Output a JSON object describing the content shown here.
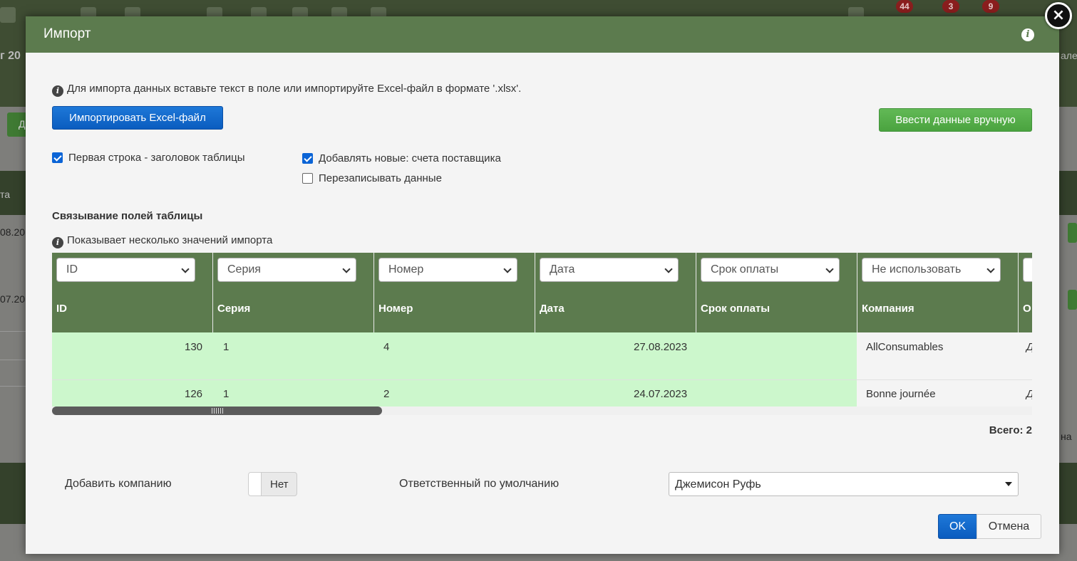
{
  "modal": {
    "title": "Импорт",
    "import_hint": "Для импорта данных вставьте текст в поле или импортируйте Excel-файл в формате '.xlsx'.",
    "import_excel_label": "Импортировать Excel-файл",
    "manual_entry_label": "Ввести данные вручную",
    "options": {
      "first_row_header": {
        "label": "Первая строка - заголовок таблицы",
        "checked": true
      },
      "add_new": {
        "label": "Добавлять новые: счета поставщика",
        "checked": true
      },
      "overwrite": {
        "label": "Перезаписывать данные",
        "checked": false
      }
    },
    "mapping_title": "Связывание полей таблицы",
    "mapping_hint": "Показывает несколько значений импорта",
    "table": {
      "field_selects": [
        "ID",
        "Серия",
        "Номер",
        "Дата",
        "Срок оплаты",
        "Не использовать"
      ],
      "headers": [
        "ID",
        "Серия",
        "Номер",
        "Дата",
        "Срок оплаты",
        "Компания",
        "О"
      ],
      "rows": [
        [
          "130",
          "1",
          "4",
          "27.08.2023",
          "",
          "AllConsumables",
          "Д"
        ],
        [
          "126",
          "1",
          "2",
          "24.07.2023",
          "",
          "Bonne journée",
          "Д"
        ]
      ]
    },
    "total": "Всего: 2",
    "add_company_label": "Добавить компанию",
    "add_company_toggle": "Нет",
    "responsible_label": "Ответственный по умолчанию",
    "responsible_value": "Джемисон Руфь",
    "ok_label": "OK",
    "cancel_label": "Отмена"
  },
  "background": {
    "badges": [
      "44",
      "3",
      "9"
    ],
    "fragments": [
      "г 20",
      "Д",
      "та",
      "08.20",
      "07.20",
      "ален",
      "на"
    ]
  }
}
